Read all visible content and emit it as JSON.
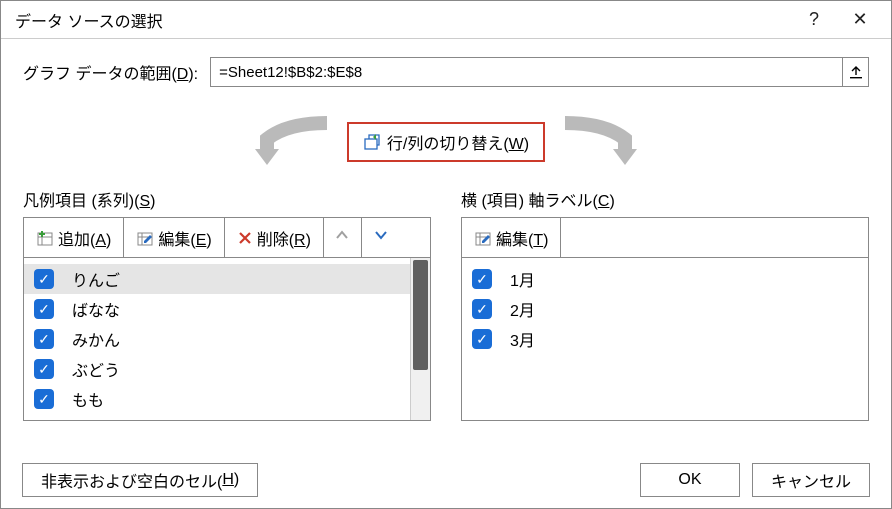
{
  "dialog": {
    "title": "データ ソースの選択",
    "help_glyph": "?",
    "close_glyph": "✕"
  },
  "range": {
    "label_pre": "グラフ データの範囲(",
    "label_key": "D",
    "label_post": "):",
    "value": "=Sheet12!$B$2:$E$8"
  },
  "swap": {
    "label_pre": "行/列の切り替え(",
    "label_key": "W",
    "label_post": ")"
  },
  "legend": {
    "section_pre": "凡例項目 (系列)(",
    "section_key": "S",
    "section_post": ")",
    "add": {
      "pre": "追加(",
      "key": "A",
      "post": ")"
    },
    "edit": {
      "pre": "編集(",
      "key": "E",
      "post": ")"
    },
    "remove": {
      "pre": "削除(",
      "key": "R",
      "post": ")"
    },
    "items": [
      "りんご",
      "ばなな",
      "みかん",
      "ぶどう",
      "もも"
    ]
  },
  "axis": {
    "section_pre": "横 (項目) 軸ラベル(",
    "section_key": "C",
    "section_post": ")",
    "edit": {
      "pre": "編集(",
      "key": "T",
      "post": ")"
    },
    "items": [
      "1月",
      "2月",
      "3月"
    ]
  },
  "footer": {
    "hidden_pre": "非表示および空白のセル(",
    "hidden_key": "H",
    "hidden_post": ")",
    "ok": "OK",
    "cancel": "キャンセル"
  }
}
